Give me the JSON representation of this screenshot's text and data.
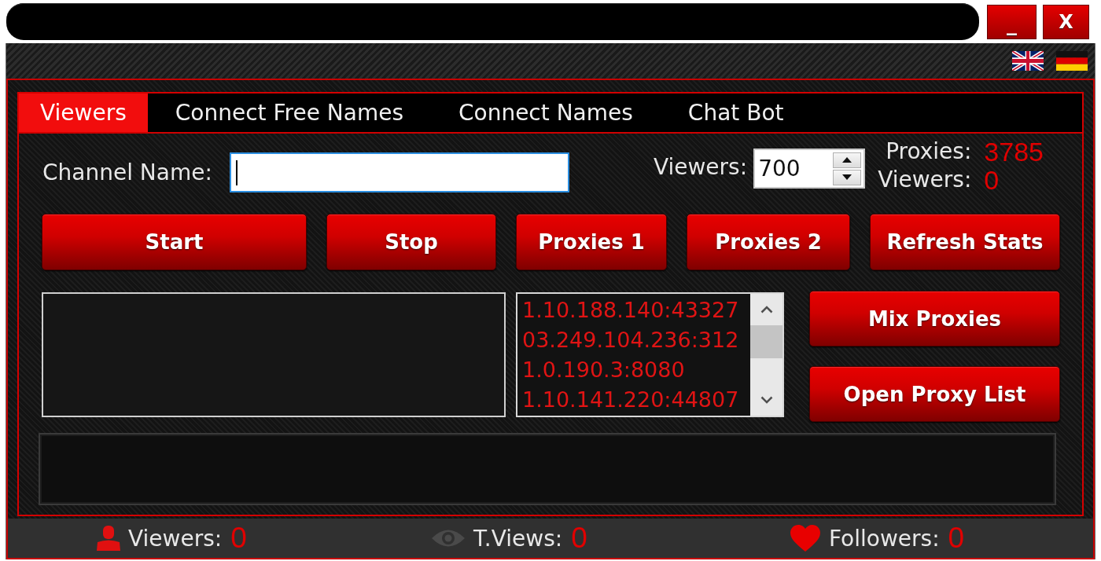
{
  "window": {
    "minimize": "_",
    "close": "X"
  },
  "tabs": [
    {
      "label": "Viewers",
      "selected": true
    },
    {
      "label": "Connect Free Names",
      "selected": false
    },
    {
      "label": "Connect Names",
      "selected": false
    },
    {
      "label": "Chat Bot",
      "selected": false
    }
  ],
  "viewers_tab": {
    "channel": {
      "label": "Channel Name:",
      "focused": true
    },
    "viewers": {
      "label": "Viewers:",
      "value": "700"
    },
    "stats": [
      {
        "label": "Proxies:",
        "value": "3785"
      },
      {
        "label": "Viewers:",
        "value": "0"
      }
    ],
    "buttons": [
      "Start",
      "Stop",
      "Proxies 1",
      "Proxies 2",
      "Refresh Stats"
    ],
    "proxy_list": [
      "1.10.188.140:43327",
      "03.249.104.236:312",
      "1.0.190.3:8080",
      "1.10.141.220:44807"
    ],
    "side_buttons": [
      "Mix Proxies",
      "Open Proxy List"
    ]
  },
  "status_bar": [
    {
      "kind": "person",
      "label": "Viewers:",
      "value": "0"
    },
    {
      "kind": "eye",
      "label": "T.Views:",
      "value": "0"
    },
    {
      "kind": "heart",
      "label": "Followers:",
      "value": "0"
    }
  ]
}
